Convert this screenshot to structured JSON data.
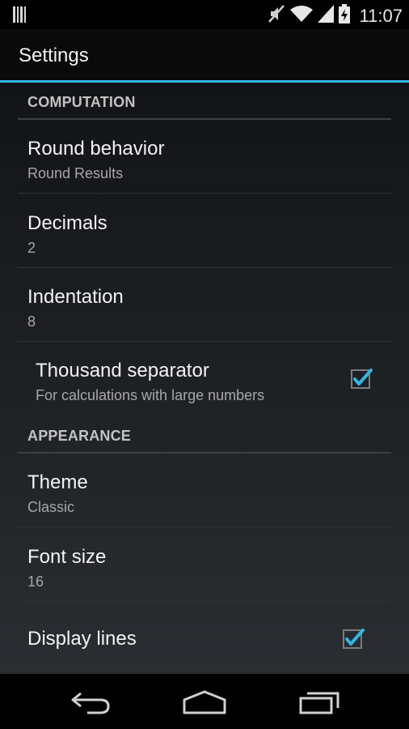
{
  "status": {
    "time": "11:07"
  },
  "actionbar": {
    "title": "Settings"
  },
  "sections": {
    "computation": {
      "header": "COMPUTATION",
      "round": {
        "title": "Round behavior",
        "summary": "Round Results"
      },
      "decimals": {
        "title": "Decimals",
        "summary": "2"
      },
      "indentation": {
        "title": "Indentation",
        "summary": "8"
      },
      "thousand": {
        "title": "Thousand separator",
        "summary": "For calculations with large numbers",
        "checked": true
      }
    },
    "appearance": {
      "header": "APPEARANCE",
      "theme": {
        "title": "Theme",
        "summary": "Classic"
      },
      "fontsize": {
        "title": "Font size",
        "summary": "16"
      },
      "displaylines": {
        "title": "Display lines",
        "checked": true
      }
    }
  },
  "colors": {
    "accent": "#33b5e5",
    "check": "#33b5e5"
  },
  "icons": [
    "barcode-icon",
    "mute-icon",
    "wifi-icon",
    "signal-icon",
    "battery-icon",
    "back-icon",
    "home-icon",
    "recents-icon"
  ]
}
